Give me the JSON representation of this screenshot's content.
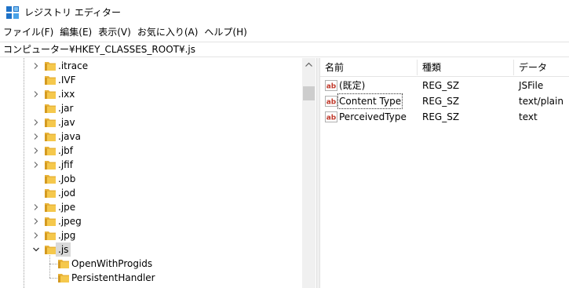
{
  "window": {
    "title": "レジストリ エディター",
    "app_icon": "registry-editor-icon"
  },
  "menubar": {
    "items": [
      {
        "label": "ファイル(F)"
      },
      {
        "label": "編集(E)"
      },
      {
        "label": "表示(V)"
      },
      {
        "label": "お気に入り(A)"
      },
      {
        "label": "ヘルプ(H)"
      }
    ]
  },
  "address": {
    "path": "コンピューター¥HKEY_CLASSES_ROOT¥.js"
  },
  "tree": {
    "items": [
      {
        "label": ".itrace",
        "expandable": true,
        "depth": 0
      },
      {
        "label": ".IVF",
        "expandable": false,
        "depth": 0
      },
      {
        "label": ".ixx",
        "expandable": true,
        "depth": 0
      },
      {
        "label": ".jar",
        "expandable": false,
        "depth": 0
      },
      {
        "label": ".jav",
        "expandable": true,
        "depth": 0
      },
      {
        "label": ".java",
        "expandable": true,
        "depth": 0
      },
      {
        "label": ".jbf",
        "expandable": true,
        "depth": 0
      },
      {
        "label": ".jfif",
        "expandable": true,
        "depth": 0
      },
      {
        "label": ".Job",
        "expandable": false,
        "depth": 0
      },
      {
        "label": ".jod",
        "expandable": false,
        "depth": 0
      },
      {
        "label": ".jpe",
        "expandable": true,
        "depth": 0
      },
      {
        "label": ".jpeg",
        "expandable": true,
        "depth": 0
      },
      {
        "label": ".jpg",
        "expandable": true,
        "depth": 0
      },
      {
        "label": ".js",
        "expandable": true,
        "expanded": true,
        "selected": true,
        "depth": 0
      },
      {
        "label": "OpenWithProgids",
        "expandable": false,
        "depth": 1
      },
      {
        "label": "PersistentHandler",
        "expandable": false,
        "depth": 1
      }
    ]
  },
  "list": {
    "columns": {
      "name": "名前",
      "type": "種類",
      "data": "データ"
    },
    "rows": [
      {
        "name": "(既定)",
        "type": "REG_SZ",
        "data": "JSFile",
        "icon": "string-value-icon"
      },
      {
        "name": "Content Type",
        "type": "REG_SZ",
        "data": "text/plain",
        "icon": "string-value-icon",
        "focused": true
      },
      {
        "name": "PerceivedType",
        "type": "REG_SZ",
        "data": "text",
        "icon": "string-value-icon"
      }
    ]
  },
  "colors": {
    "folder": "#e8b339",
    "folder_dark": "#d49a20",
    "selection": "#d9d9d9",
    "value_icon_red": "#c0392b"
  }
}
